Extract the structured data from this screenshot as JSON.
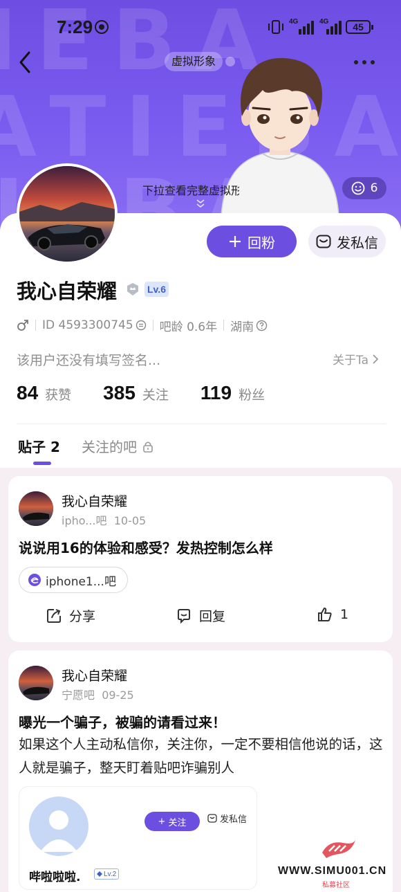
{
  "status_bar": {
    "time": "7:29",
    "battery": "45",
    "network_labels": [
      "4G",
      "4G"
    ]
  },
  "header": {
    "virtual_tag": "虚拟形象",
    "pull_hint": "下拉查看完整虚拟形象",
    "like_count": "6",
    "background_watermark": "TIEBA"
  },
  "actions": {
    "follow_back": "回粉",
    "send_message": "发私信"
  },
  "profile": {
    "username": "我心自荣耀",
    "level": "Lv.6",
    "gender_icon": "male-icon",
    "id": "ID 4593300745",
    "age": "吧龄 0.6年",
    "location": "湖南",
    "bio": "该用户还没有填写签名...",
    "about_label": "关于Ta"
  },
  "stats": [
    {
      "value": "84",
      "label": "获赞"
    },
    {
      "value": "385",
      "label": "关注"
    },
    {
      "value": "119",
      "label": "粉丝"
    }
  ],
  "tabs": {
    "posts": "贴子 2",
    "followed_bars": "关注的吧"
  },
  "posts": [
    {
      "author": "我心自荣耀",
      "bar": "ipho...吧",
      "date": "10-05",
      "title": "说说用16的体验和感受？发热控制怎么样",
      "bar_chip": "iphone1...吧",
      "share": "分享",
      "reply": "回复",
      "likes": "1"
    },
    {
      "author": "我心自荣耀",
      "bar": "宁愿吧",
      "date": "09-25",
      "title": "曝光一个骗子，被骗的请看过来！",
      "body": "如果这个人主动私信你，关注你，一定不要相信他说的话，这人就是骗子，整天盯着贴吧诈骗别人",
      "embed": {
        "follow": "关注",
        "message": "发私信",
        "name": "哔啦啦啦.",
        "level": "Lv.2"
      }
    }
  ],
  "watermark": {
    "site": "WWW.SIMU001.CN",
    "label": "私募社区"
  },
  "colors": {
    "accent": "#6c4fe0",
    "header_bg": "#7a5cf0",
    "page_bg": "#f6eef2"
  }
}
